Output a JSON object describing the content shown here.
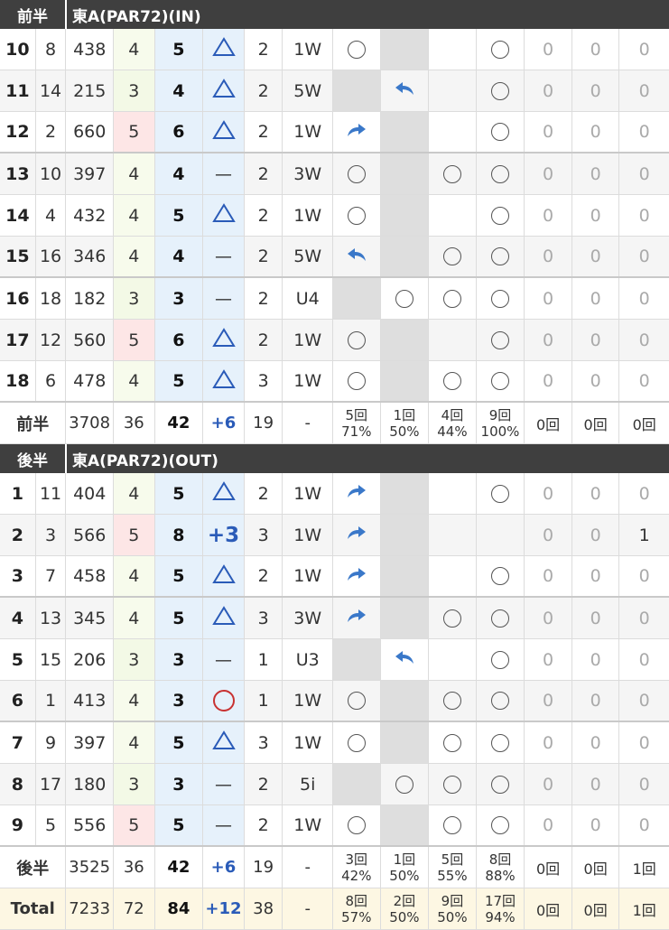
{
  "front": {
    "label": "前半",
    "course": "東A(PAR72)(IN)"
  },
  "back": {
    "label": "後半",
    "course": "東A(PAR72)(OUT)"
  },
  "front_holes": [
    {
      "hole": "10",
      "hdcp": "8",
      "yards": "438",
      "par": "4",
      "score": "5",
      "mark": "tri",
      "putts": "2",
      "club": "1W",
      "fw": "circ",
      "gr": "gray",
      "b1": "",
      "b2": "circ",
      "z1": "0",
      "z2": "0",
      "z3": "0"
    },
    {
      "hole": "11",
      "hdcp": "14",
      "yards": "215",
      "par": "3",
      "score": "4",
      "mark": "tri",
      "putts": "2",
      "club": "5W",
      "fw": "gray",
      "gr": "left",
      "b1": "",
      "b2": "circ",
      "z1": "0",
      "z2": "0",
      "z3": "0"
    },
    {
      "hole": "12",
      "hdcp": "2",
      "yards": "660",
      "par": "5",
      "score": "6",
      "mark": "tri",
      "putts": "2",
      "club": "1W",
      "fw": "right",
      "gr": "gray",
      "b1": "",
      "b2": "circ",
      "z1": "0",
      "z2": "0",
      "z3": "0"
    },
    {
      "hole": "13",
      "hdcp": "10",
      "yards": "397",
      "par": "4",
      "score": "4",
      "mark": "dash",
      "putts": "2",
      "club": "3W",
      "fw": "circ",
      "gr": "gray",
      "b1": "circ",
      "b2": "circ",
      "z1": "0",
      "z2": "0",
      "z3": "0"
    },
    {
      "hole": "14",
      "hdcp": "4",
      "yards": "432",
      "par": "4",
      "score": "5",
      "mark": "tri",
      "putts": "2",
      "club": "1W",
      "fw": "circ",
      "gr": "gray",
      "b1": "",
      "b2": "circ",
      "z1": "0",
      "z2": "0",
      "z3": "0"
    },
    {
      "hole": "15",
      "hdcp": "16",
      "yards": "346",
      "par": "4",
      "score": "4",
      "mark": "dash",
      "putts": "2",
      "club": "5W",
      "fw": "left",
      "gr": "gray",
      "b1": "circ",
      "b2": "circ",
      "z1": "0",
      "z2": "0",
      "z3": "0"
    },
    {
      "hole": "16",
      "hdcp": "18",
      "yards": "182",
      "par": "3",
      "score": "3",
      "mark": "dash",
      "putts": "2",
      "club": "U4",
      "fw": "gray",
      "gr": "circ",
      "b1": "circ",
      "b2": "circ",
      "z1": "0",
      "z2": "0",
      "z3": "0"
    },
    {
      "hole": "17",
      "hdcp": "12",
      "yards": "560",
      "par": "5",
      "score": "6",
      "mark": "tri",
      "putts": "2",
      "club": "1W",
      "fw": "circ",
      "gr": "gray",
      "b1": "",
      "b2": "circ",
      "z1": "0",
      "z2": "0",
      "z3": "0"
    },
    {
      "hole": "18",
      "hdcp": "6",
      "yards": "478",
      "par": "4",
      "score": "5",
      "mark": "tri",
      "putts": "3",
      "club": "1W",
      "fw": "circ",
      "gr": "gray",
      "b1": "circ",
      "b2": "circ",
      "z1": "0",
      "z2": "0",
      "z3": "0"
    }
  ],
  "front_sum": {
    "label": "前半",
    "yards": "3708",
    "par": "36",
    "score": "42",
    "diff": "+6",
    "putts": "19",
    "club": "-",
    "fw": [
      "5回",
      "71%"
    ],
    "gr": [
      "1回",
      "50%"
    ],
    "b1": [
      "4回",
      "44%"
    ],
    "b2": [
      "9回",
      "100%"
    ],
    "z1": "0回",
    "z2": "0回",
    "z3": "0回"
  },
  "back_holes": [
    {
      "hole": "1",
      "hdcp": "11",
      "yards": "404",
      "par": "4",
      "score": "5",
      "mark": "tri",
      "putts": "2",
      "club": "1W",
      "fw": "right",
      "gr": "gray",
      "b1": "",
      "b2": "circ",
      "z1": "0",
      "z2": "0",
      "z3": "0"
    },
    {
      "hole": "2",
      "hdcp": "3",
      "yards": "566",
      "par": "5",
      "score": "8",
      "mark": "+3",
      "putts": "3",
      "club": "1W",
      "fw": "right",
      "gr": "gray",
      "b1": "",
      "b2": "",
      "z1": "0",
      "z2": "0",
      "z3": "1"
    },
    {
      "hole": "3",
      "hdcp": "7",
      "yards": "458",
      "par": "4",
      "score": "5",
      "mark": "tri",
      "putts": "2",
      "club": "1W",
      "fw": "right",
      "gr": "gray",
      "b1": "",
      "b2": "circ",
      "z1": "0",
      "z2": "0",
      "z3": "0"
    },
    {
      "hole": "4",
      "hdcp": "13",
      "yards": "345",
      "par": "4",
      "score": "5",
      "mark": "tri",
      "putts": "3",
      "club": "3W",
      "fw": "right",
      "gr": "gray",
      "b1": "circ",
      "b2": "circ",
      "z1": "0",
      "z2": "0",
      "z3": "0"
    },
    {
      "hole": "5",
      "hdcp": "15",
      "yards": "206",
      "par": "3",
      "score": "3",
      "mark": "dash",
      "putts": "1",
      "club": "U3",
      "fw": "gray",
      "gr": "left",
      "b1": "",
      "b2": "circ",
      "z1": "0",
      "z2": "0",
      "z3": "0"
    },
    {
      "hole": "6",
      "hdcp": "1",
      "yards": "413",
      "par": "4",
      "score": "3",
      "mark": "redcirc",
      "putts": "1",
      "club": "1W",
      "fw": "circ",
      "gr": "gray",
      "b1": "circ",
      "b2": "circ",
      "z1": "0",
      "z2": "0",
      "z3": "0"
    },
    {
      "hole": "7",
      "hdcp": "9",
      "yards": "397",
      "par": "4",
      "score": "5",
      "mark": "tri",
      "putts": "3",
      "club": "1W",
      "fw": "circ",
      "gr": "gray",
      "b1": "circ",
      "b2": "circ",
      "z1": "0",
      "z2": "0",
      "z3": "0"
    },
    {
      "hole": "8",
      "hdcp": "17",
      "yards": "180",
      "par": "3",
      "score": "3",
      "mark": "dash",
      "putts": "2",
      "club": "5i",
      "fw": "gray",
      "gr": "circ",
      "b1": "circ",
      "b2": "circ",
      "z1": "0",
      "z2": "0",
      "z3": "0"
    },
    {
      "hole": "9",
      "hdcp": "5",
      "yards": "556",
      "par": "5",
      "score": "5",
      "mark": "dash",
      "putts": "2",
      "club": "1W",
      "fw": "circ",
      "gr": "gray",
      "b1": "circ",
      "b2": "circ",
      "z1": "0",
      "z2": "0",
      "z3": "0"
    }
  ],
  "back_sum": {
    "label": "後半",
    "yards": "3525",
    "par": "36",
    "score": "42",
    "diff": "+6",
    "putts": "19",
    "club": "-",
    "fw": [
      "3回",
      "42%"
    ],
    "gr": [
      "1回",
      "50%"
    ],
    "b1": [
      "5回",
      "55%"
    ],
    "b2": [
      "8回",
      "88%"
    ],
    "z1": "0回",
    "z2": "0回",
    "z3": "1回"
  },
  "total_sum": {
    "label": "Total",
    "yards": "7233",
    "par": "72",
    "score": "84",
    "diff": "+12",
    "putts": "38",
    "club": "-",
    "fw": [
      "8回",
      "57%"
    ],
    "gr": [
      "2回",
      "50%"
    ],
    "b1": [
      "9回",
      "50%"
    ],
    "b2": [
      "17回",
      "94%"
    ],
    "z1": "0回",
    "z2": "0回",
    "z3": "1回"
  }
}
